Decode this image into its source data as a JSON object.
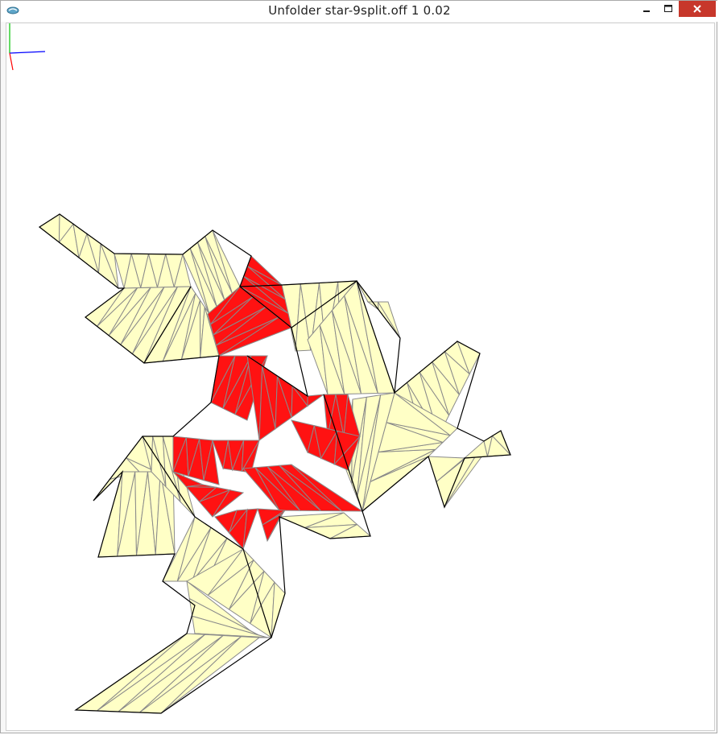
{
  "window": {
    "title": "Unfolder star-9split.off 1 0.02",
    "icon": "unfolder-app-icon"
  },
  "controls": {
    "minimize_icon": "minimize-icon",
    "maximize_icon": "maximize-icon",
    "close_icon": "close-icon",
    "close_color": "#c7372b"
  },
  "viewport": {
    "background": "#ffffff",
    "mesh_fill_color": "#ffffc6",
    "highlight_fill_color": "#ff1212",
    "cut_edge_color": "#000000",
    "fold_edge_color": "#8a8a8a"
  },
  "axes": {
    "x_color": "#0000ff",
    "y_color": "#00c000",
    "z_color": "#ff0000"
  }
}
